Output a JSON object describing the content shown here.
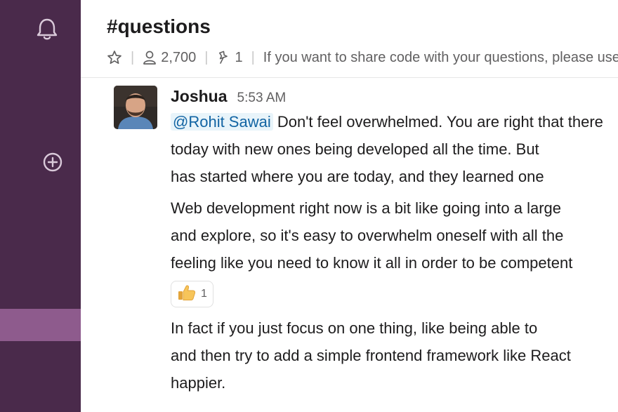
{
  "channel": {
    "name": "#questions",
    "member_count": "2,700",
    "pinned_count": "1",
    "topic": "If you want to share code with your questions, please use"
  },
  "message": {
    "sender": "Joshua",
    "time": "5:53 AM",
    "mention": "@Rohit Sawai",
    "p1_line1_rest": "Don't feel overwhelmed. You are right that there",
    "p1_line2": "today with new ones being developed all the time. But",
    "p1_line3": "has started where you are today, and they learned one",
    "p2_line1": "Web development right now is a bit like going into a large",
    "p2_line2": "and explore, so it's easy to overwhelm oneself with all the",
    "p2_line3": "feeling like you need to know it all in order to be competent",
    "reaction_count": "1",
    "p3_line1": "In fact if you just focus on one thing, like being able to",
    "p3_line2": "and then try to add a simple frontend framework like React",
    "p3_line3": "happier."
  },
  "colors": {
    "sidebar": "#4a2a4b",
    "sidebar_active": "#8e5b8d",
    "mention_text": "#1264a3",
    "mention_bg": "#e8f4fa"
  },
  "icons": {
    "sidebar": [
      "bell-icon",
      "add-circle-icon"
    ],
    "header": [
      "star-icon",
      "person-icon",
      "pin-icon"
    ],
    "reaction": "thumbs-up-icon"
  }
}
